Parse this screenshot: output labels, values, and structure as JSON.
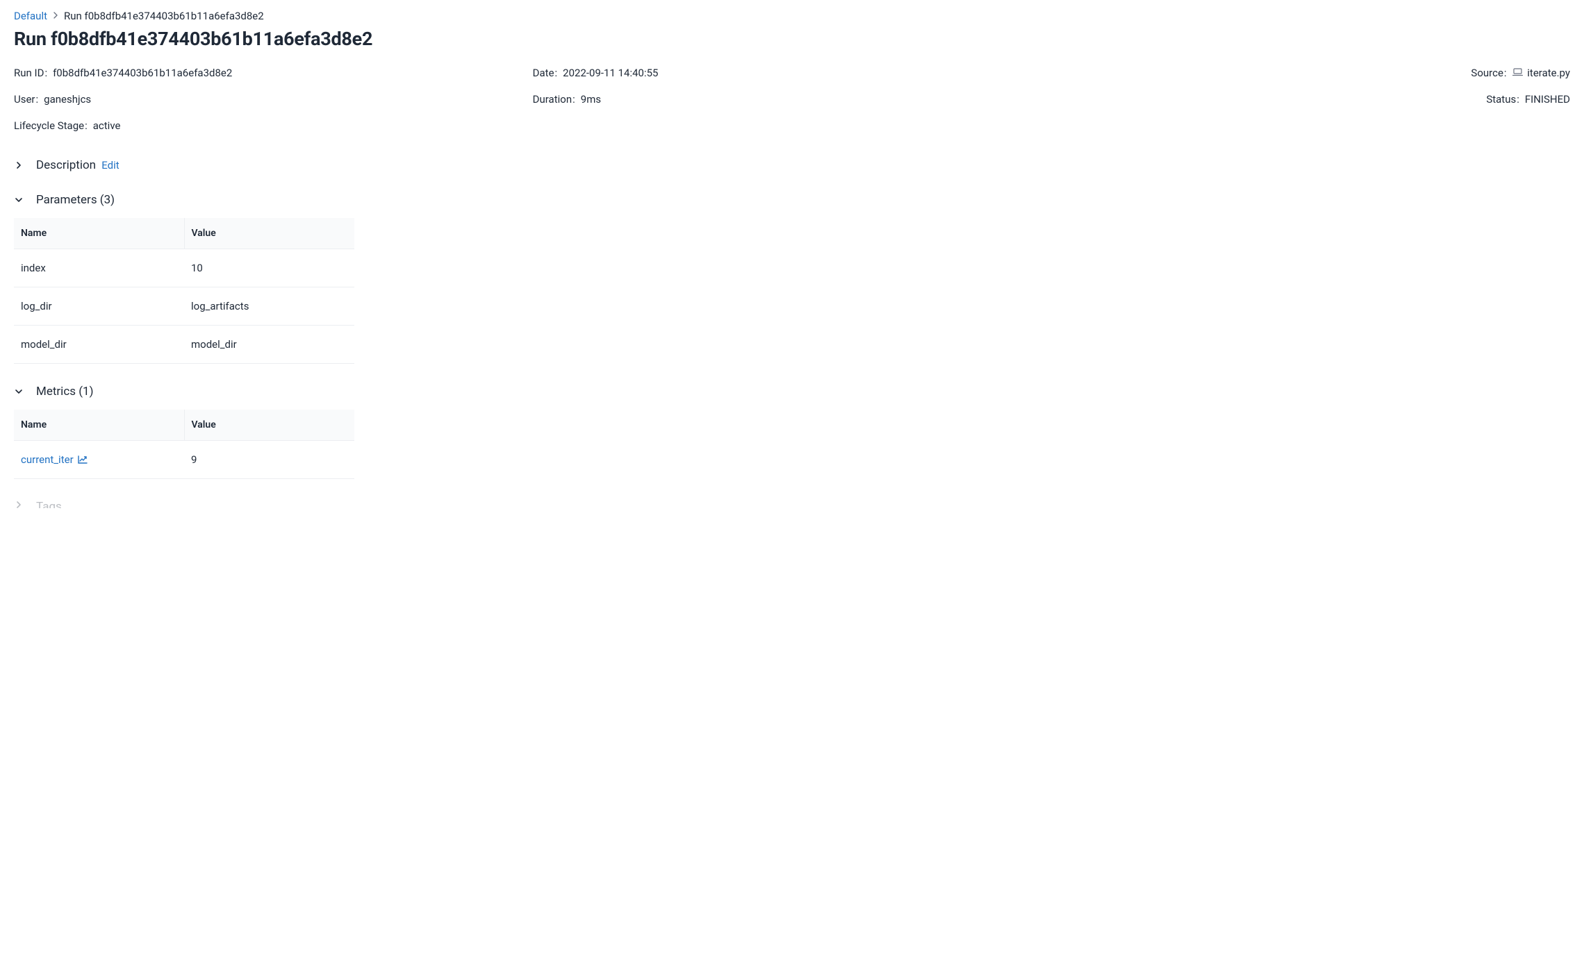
{
  "breadcrumb": {
    "root": "Default",
    "current": "Run f0b8dfb41e374403b61b11a6efa3d8e2"
  },
  "page_title": "Run f0b8dfb41e374403b61b11a6efa3d8e2",
  "meta": {
    "run_id_label": "Run ID",
    "run_id": "f0b8dfb41e374403b61b11a6efa3d8e2",
    "date_label": "Date",
    "date": "2022-09-11 14:40:55",
    "source_label": "Source",
    "source": "iterate.py",
    "user_label": "User",
    "user": "ganeshjcs",
    "duration_label": "Duration",
    "duration": "9ms",
    "status_label": "Status",
    "status": "FINISHED",
    "lifecycle_label": "Lifecycle Stage",
    "lifecycle": "active"
  },
  "sections": {
    "description": {
      "title": "Description",
      "edit": "Edit"
    },
    "parameters": {
      "title": "Parameters (3)",
      "columns": {
        "name": "Name",
        "value": "Value"
      },
      "rows": [
        {
          "name": "index",
          "value": "10"
        },
        {
          "name": "log_dir",
          "value": "log_artifacts"
        },
        {
          "name": "model_dir",
          "value": "model_dir"
        }
      ]
    },
    "metrics": {
      "title": "Metrics (1)",
      "columns": {
        "name": "Name",
        "value": "Value"
      },
      "rows": [
        {
          "name": "current_iter",
          "value": "9"
        }
      ]
    },
    "tags": {
      "title": "Tags"
    }
  }
}
